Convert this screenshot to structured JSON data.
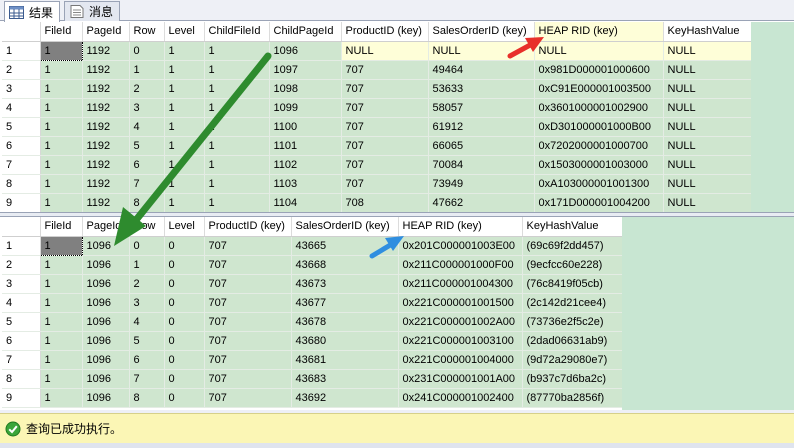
{
  "tabs": [
    {
      "label": "结果",
      "icon": "grid-icon",
      "active": true
    },
    {
      "label": "消息",
      "icon": "message-icon",
      "active": false
    }
  ],
  "grid1": {
    "columns": [
      "",
      "FileId",
      "PageId",
      "Row",
      "Level",
      "ChildFileId",
      "ChildPageId",
      "ProductID (key)",
      "SalesOrderID (key)",
      "HEAP RID (key)",
      "KeyHashValue"
    ],
    "rows": [
      [
        "1",
        "1",
        "1192",
        "0",
        "1",
        "1",
        "1096",
        "NULL",
        "NULL",
        "NULL",
        "NULL"
      ],
      [
        "2",
        "1",
        "1192",
        "1",
        "1",
        "1",
        "1097",
        "707",
        "49464",
        "0x981D000001000600",
        "NULL"
      ],
      [
        "3",
        "1",
        "1192",
        "2",
        "1",
        "1",
        "1098",
        "707",
        "53633",
        "0xC91E000001003500",
        "NULL"
      ],
      [
        "4",
        "1",
        "1192",
        "3",
        "1",
        "1",
        "1099",
        "707",
        "58057",
        "0x3601000001002900",
        "NULL"
      ],
      [
        "5",
        "1",
        "1192",
        "4",
        "1",
        "1",
        "1100",
        "707",
        "61912",
        "0xD301000001000B00",
        "NULL"
      ],
      [
        "6",
        "1",
        "1192",
        "5",
        "1",
        "1",
        "1101",
        "707",
        "66065",
        "0x7202000001000700",
        "NULL"
      ],
      [
        "7",
        "1",
        "1192",
        "6",
        "1",
        "1",
        "1102",
        "707",
        "70084",
        "0x1503000001003000",
        "NULL"
      ],
      [
        "8",
        "1",
        "1192",
        "7",
        "1",
        "1",
        "1103",
        "707",
        "73949",
        "0xA103000001001300",
        "NULL"
      ],
      [
        "9",
        "1",
        "1192",
        "8",
        "1",
        "1",
        "1104",
        "708",
        "47662",
        "0x171D000001004200",
        "NULL"
      ]
    ]
  },
  "grid2": {
    "columns": [
      "",
      "FileId",
      "PageId",
      "Row",
      "Level",
      "ProductID (key)",
      "SalesOrderID (key)",
      "HEAP RID (key)",
      "KeyHashValue"
    ],
    "rows": [
      [
        "1",
        "1",
        "1096",
        "0",
        "0",
        "707",
        "43665",
        "0x201C000001003E00",
        "(69c69f2dd457)"
      ],
      [
        "2",
        "1",
        "1096",
        "1",
        "0",
        "707",
        "43668",
        "0x211C000001000F00",
        "(9ecfcc60e228)"
      ],
      [
        "3",
        "1",
        "1096",
        "2",
        "0",
        "707",
        "43673",
        "0x211C000001004300",
        "(76c8419f05cb)"
      ],
      [
        "4",
        "1",
        "1096",
        "3",
        "0",
        "707",
        "43677",
        "0x221C000001001500",
        "(2c142d21cee4)"
      ],
      [
        "5",
        "1",
        "1096",
        "4",
        "0",
        "707",
        "43678",
        "0x221C000001002A00",
        "(73736e2f5c2e)"
      ],
      [
        "6",
        "1",
        "1096",
        "5",
        "0",
        "707",
        "43680",
        "0x221C000001003100",
        "(2dad06631ab9)"
      ],
      [
        "7",
        "1",
        "1096",
        "6",
        "0",
        "707",
        "43681",
        "0x221C000001004000",
        "(9d72a29080e7)"
      ],
      [
        "8",
        "1",
        "1096",
        "7",
        "0",
        "707",
        "43683",
        "0x231C000001001A00",
        "(b937c7d6ba2c)"
      ],
      [
        "9",
        "1",
        "1096",
        "8",
        "0",
        "707",
        "43692",
        "0x241C000001002400",
        "(87770ba2856f)"
      ]
    ]
  },
  "status": {
    "text": "查询已成功执行。",
    "icon": "success-check-icon"
  },
  "annotations": [
    {
      "name": "green-arrow",
      "color": "#2e8b2e"
    },
    {
      "name": "red-arrow",
      "color": "#e8302a"
    },
    {
      "name": "blue-arrow",
      "color": "#2f8ee0"
    }
  ],
  "colors": {
    "cell": "#cfe6cf",
    "highlight": "#fefed8",
    "status_bg": "#fbf6b5",
    "selected": "#808080"
  }
}
